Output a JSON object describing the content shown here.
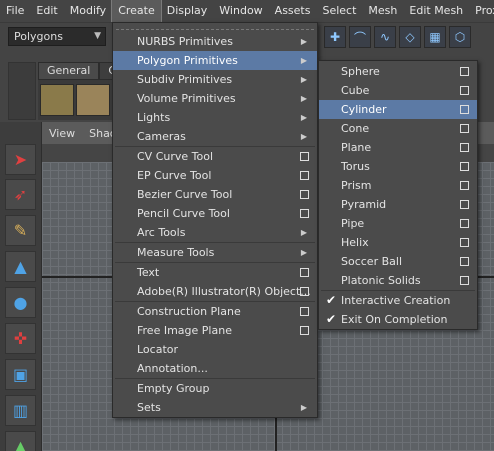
{
  "menubar": [
    "File",
    "Edit",
    "Modify",
    "Create",
    "Display",
    "Window",
    "Assets",
    "Select",
    "Mesh",
    "Edit Mesh",
    "Proxy"
  ],
  "statusline": {
    "mode": "Polygons"
  },
  "shelf": {
    "tabs": [
      "General",
      "C"
    ]
  },
  "viewport": {
    "menus": [
      "View",
      "Shad"
    ]
  },
  "create_menu": [
    {
      "label": "NURBS Primitives",
      "kind": "submenu"
    },
    {
      "label": "Polygon Primitives",
      "kind": "submenu",
      "highlighted": true
    },
    {
      "label": "Subdiv Primitives",
      "kind": "submenu"
    },
    {
      "label": "Volume Primitives",
      "kind": "submenu"
    },
    {
      "label": "Lights",
      "kind": "submenu"
    },
    {
      "label": "Cameras",
      "kind": "submenu",
      "sep_after": true
    },
    {
      "label": "CV Curve Tool",
      "kind": "option"
    },
    {
      "label": "EP Curve Tool",
      "kind": "option"
    },
    {
      "label": "Bezier Curve Tool",
      "kind": "option"
    },
    {
      "label": "Pencil Curve Tool",
      "kind": "option"
    },
    {
      "label": "Arc Tools",
      "kind": "submenu",
      "sep_after": true
    },
    {
      "label": "Measure Tools",
      "kind": "submenu",
      "sep_after": true
    },
    {
      "label": "Text",
      "kind": "option"
    },
    {
      "label": "Adobe(R) Illustrator(R) Object...",
      "kind": "option",
      "sep_after": true
    },
    {
      "label": "Construction Plane",
      "kind": "option"
    },
    {
      "label": "Free Image Plane",
      "kind": "option"
    },
    {
      "label": "Locator",
      "kind": "plain"
    },
    {
      "label": "Annotation...",
      "kind": "plain",
      "sep_after": true
    },
    {
      "label": "Empty Group",
      "kind": "plain"
    },
    {
      "label": "Sets",
      "kind": "submenu"
    }
  ],
  "polygon_menu": [
    {
      "label": "Sphere",
      "kind": "option"
    },
    {
      "label": "Cube",
      "kind": "option"
    },
    {
      "label": "Cylinder",
      "kind": "option",
      "highlighted": true
    },
    {
      "label": "Cone",
      "kind": "option"
    },
    {
      "label": "Plane",
      "kind": "option"
    },
    {
      "label": "Torus",
      "kind": "option"
    },
    {
      "label": "Prism",
      "kind": "option"
    },
    {
      "label": "Pyramid",
      "kind": "option"
    },
    {
      "label": "Pipe",
      "kind": "option"
    },
    {
      "label": "Helix",
      "kind": "option"
    },
    {
      "label": "Soccer Ball",
      "kind": "option"
    },
    {
      "label": "Platonic Solids",
      "kind": "option",
      "sep_after": true
    },
    {
      "label": "Interactive Creation",
      "kind": "checked"
    },
    {
      "label": "Exit On Completion",
      "kind": "checked"
    }
  ]
}
